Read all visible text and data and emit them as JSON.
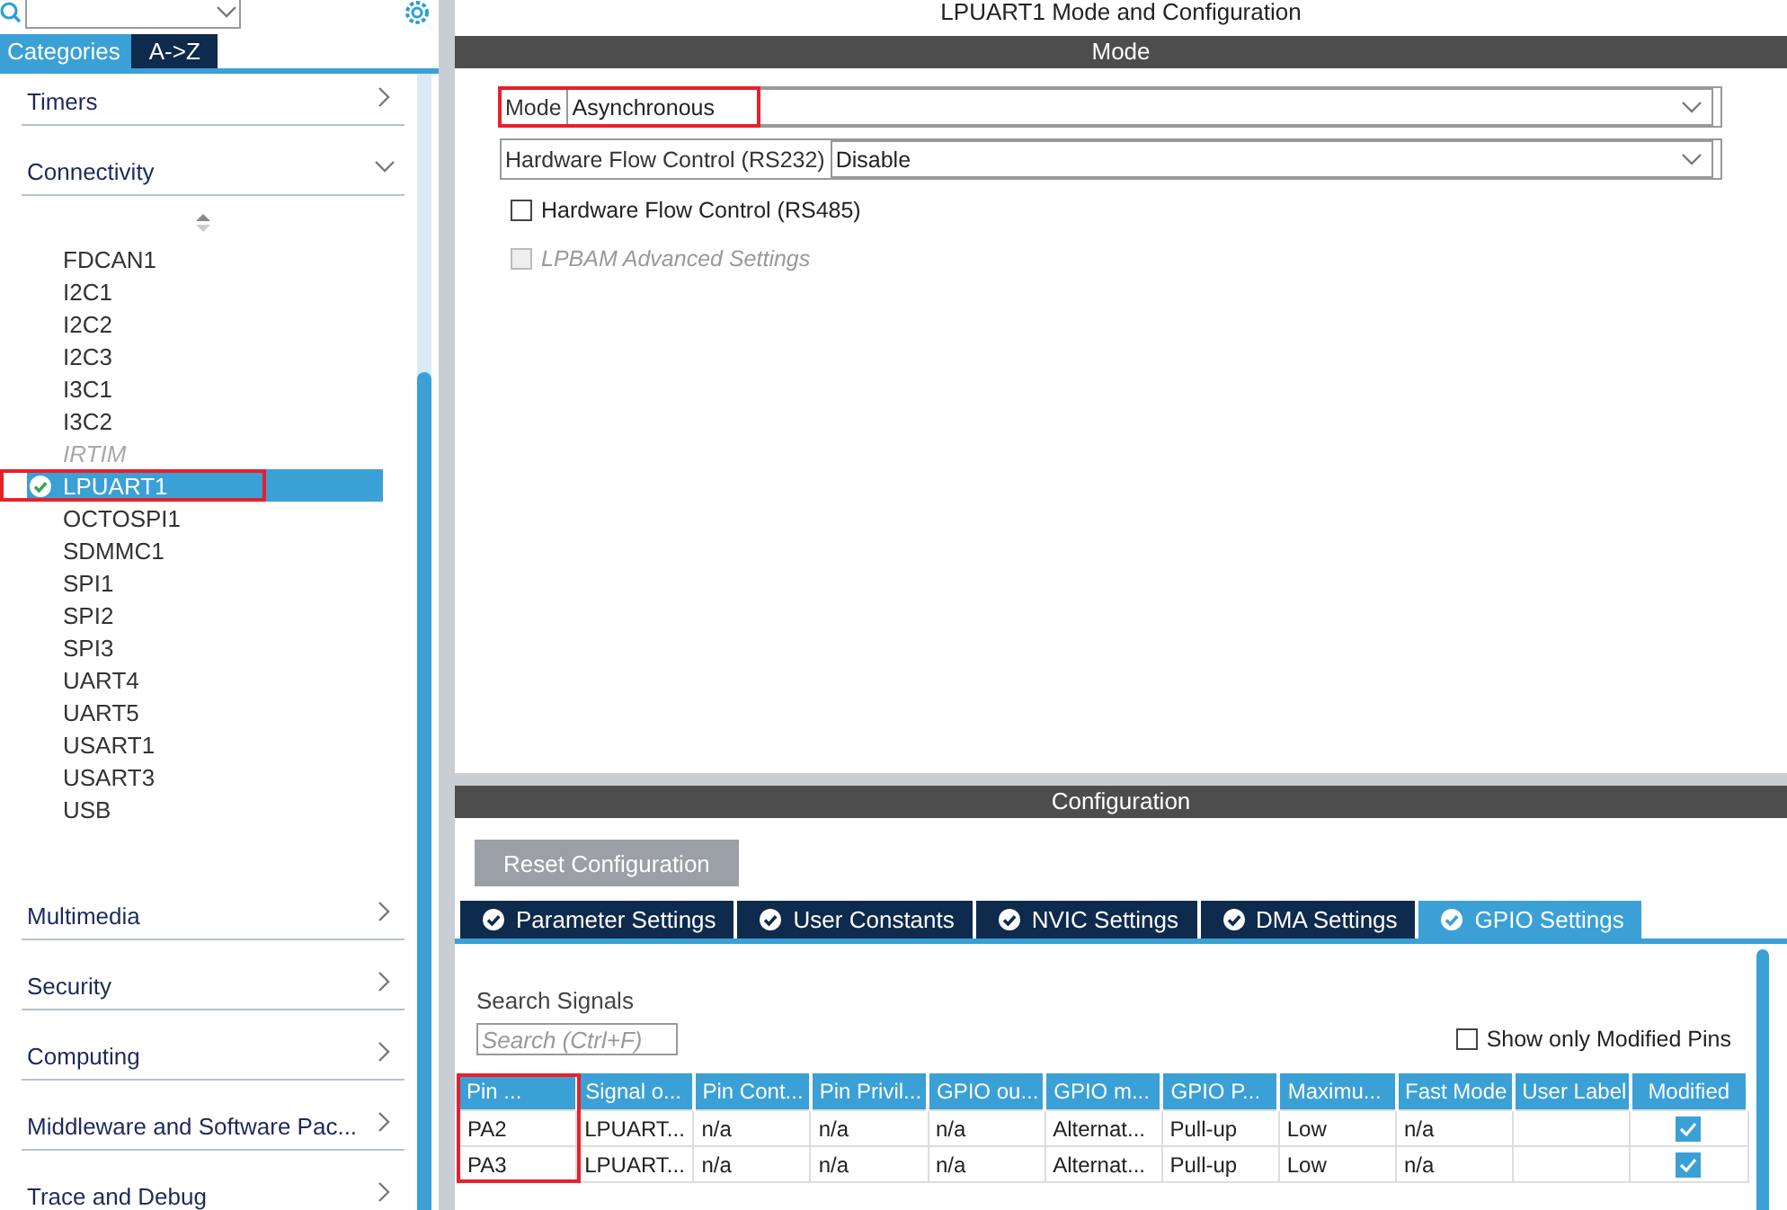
{
  "sidebar": {
    "tabs": [
      {
        "label": "Categories",
        "selected": true
      },
      {
        "label": "A->Z",
        "selected": false
      }
    ],
    "categories": [
      {
        "label": "Timers",
        "expanded": false
      },
      {
        "label": "Connectivity",
        "expanded": true,
        "children": [
          {
            "label": "FDCAN1",
            "selected": false,
            "configured": false,
            "disabled": false
          },
          {
            "label": "I2C1",
            "selected": false,
            "configured": false,
            "disabled": false
          },
          {
            "label": "I2C2",
            "selected": false,
            "configured": false,
            "disabled": false
          },
          {
            "label": "I2C3",
            "selected": false,
            "configured": false,
            "disabled": false
          },
          {
            "label": "I3C1",
            "selected": false,
            "configured": false,
            "disabled": false
          },
          {
            "label": "I3C2",
            "selected": false,
            "configured": false,
            "disabled": false
          },
          {
            "label": "IRTIM",
            "selected": false,
            "configured": false,
            "disabled": true
          },
          {
            "label": "LPUART1",
            "selected": true,
            "configured": true,
            "disabled": false,
            "highlighted": true
          },
          {
            "label": "OCTOSPI1",
            "selected": false,
            "configured": false,
            "disabled": false
          },
          {
            "label": "SDMMC1",
            "selected": false,
            "configured": false,
            "disabled": false
          },
          {
            "label": "SPI1",
            "selected": false,
            "configured": false,
            "disabled": false
          },
          {
            "label": "SPI2",
            "selected": false,
            "configured": false,
            "disabled": false
          },
          {
            "label": "SPI3",
            "selected": false,
            "configured": false,
            "disabled": false
          },
          {
            "label": "UART4",
            "selected": false,
            "configured": false,
            "disabled": false
          },
          {
            "label": "UART5",
            "selected": false,
            "configured": false,
            "disabled": false
          },
          {
            "label": "USART1",
            "selected": false,
            "configured": false,
            "disabled": false
          },
          {
            "label": "USART3",
            "selected": false,
            "configured": false,
            "disabled": false
          },
          {
            "label": "USB",
            "selected": false,
            "configured": false,
            "disabled": false
          }
        ]
      },
      {
        "label": "Multimedia",
        "expanded": false
      },
      {
        "label": "Security",
        "expanded": false
      },
      {
        "label": "Computing",
        "expanded": false
      },
      {
        "label": "Middleware and Software Pac...",
        "expanded": false
      },
      {
        "label": "Trace and Debug",
        "expanded": false
      }
    ]
  },
  "main": {
    "title": "LPUART1 Mode and Configuration",
    "mode": {
      "header": "Mode",
      "fields": [
        {
          "kind": "select",
          "label": "Mode",
          "value": "Asynchronous",
          "highlighted": true
        },
        {
          "kind": "select",
          "label": "Hardware Flow Control (RS232)",
          "value": "Disable",
          "highlighted": false
        },
        {
          "kind": "checkbox",
          "label": "Hardware Flow Control (RS485)",
          "checked": false,
          "disabled": false
        },
        {
          "kind": "checkbox",
          "label": "LPBAM Advanced Settings",
          "checked": false,
          "disabled": true
        }
      ]
    },
    "configuration": {
      "header": "Configuration",
      "reset_button": "Reset Configuration",
      "tabs": [
        {
          "label": "Parameter Settings",
          "selected": false
        },
        {
          "label": "User Constants",
          "selected": false
        },
        {
          "label": "NVIC Settings",
          "selected": false
        },
        {
          "label": "DMA Settings",
          "selected": false
        },
        {
          "label": "GPIO Settings",
          "selected": true
        }
      ],
      "search_label": "Search Signals",
      "search": {
        "placeholder": "Search (Ctrl+F)"
      },
      "show_modified": {
        "label": "Show only Modified Pins",
        "checked": false
      },
      "table": {
        "columns": [
          {
            "label": "Pin ...",
            "highlighted": true
          },
          {
            "label": "Signal o...",
            "highlighted": false
          },
          {
            "label": "Pin Cont...",
            "highlighted": false
          },
          {
            "label": "Pin Privil...",
            "highlighted": false
          },
          {
            "label": "GPIO ou...",
            "highlighted": false
          },
          {
            "label": "GPIO m...",
            "highlighted": false
          },
          {
            "label": "GPIO P...",
            "highlighted": false
          },
          {
            "label": "Maximu...",
            "highlighted": false
          },
          {
            "label": "Fast Mode",
            "highlighted": false
          },
          {
            "label": "User Label",
            "highlighted": false
          },
          {
            "label": "Modified",
            "highlighted": false
          }
        ],
        "rows": [
          {
            "cells": [
              "PA2",
              "LPUART...",
              "n/a",
              "n/a",
              "n/a",
              "Alternat...",
              "Pull-up",
              "Low",
              "n/a",
              ""
            ],
            "modified": true
          },
          {
            "cells": [
              "PA3",
              "LPUART...",
              "n/a",
              "n/a",
              "n/a",
              "Alternat...",
              "Pull-up",
              "Low",
              "n/a",
              ""
            ],
            "modified": true
          }
        ]
      }
    }
  }
}
